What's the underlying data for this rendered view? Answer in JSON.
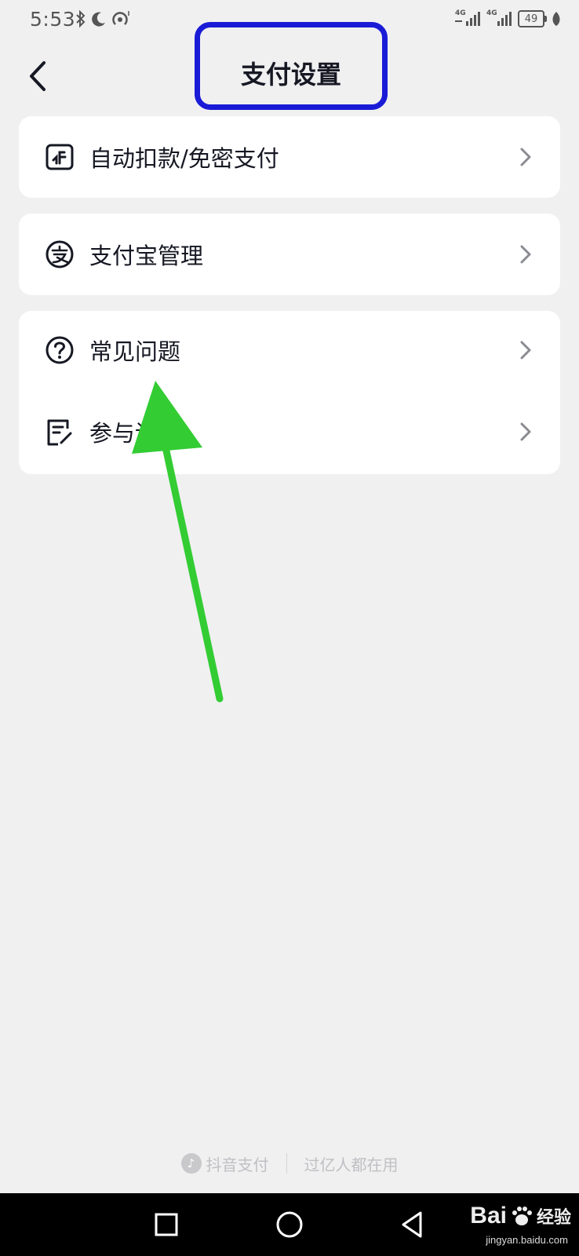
{
  "status_bar": {
    "time": "5:53",
    "signal1_label": "4G",
    "signal2_label": "4G",
    "battery": "49"
  },
  "header": {
    "title": "支付设置"
  },
  "menu": {
    "auto_pay": "自动扣款/免密支付",
    "alipay": "支付宝管理",
    "faq": "常见问题",
    "feedback": "参与讨"
  },
  "footer": {
    "brand": "抖音支付",
    "slogan": "过亿人都在用"
  },
  "watermark": {
    "main": "Bai",
    "jingyan": "经验",
    "url": "jingyan.baidu.com"
  },
  "colors": {
    "highlight_box": "#1a1bd6",
    "annotation_arrow": "#33cc33",
    "background": "#f0f0f1"
  },
  "icons": [
    "bluetooth-icon",
    "moon-icon",
    "hotspot-icon",
    "signal-icon",
    "battery-icon",
    "leaf-icon",
    "back-icon",
    "payment-card-icon",
    "alipay-icon",
    "question-icon",
    "edit-note-icon",
    "chevron-right-icon",
    "square-icon",
    "circle-icon",
    "triangle-back-icon"
  ]
}
